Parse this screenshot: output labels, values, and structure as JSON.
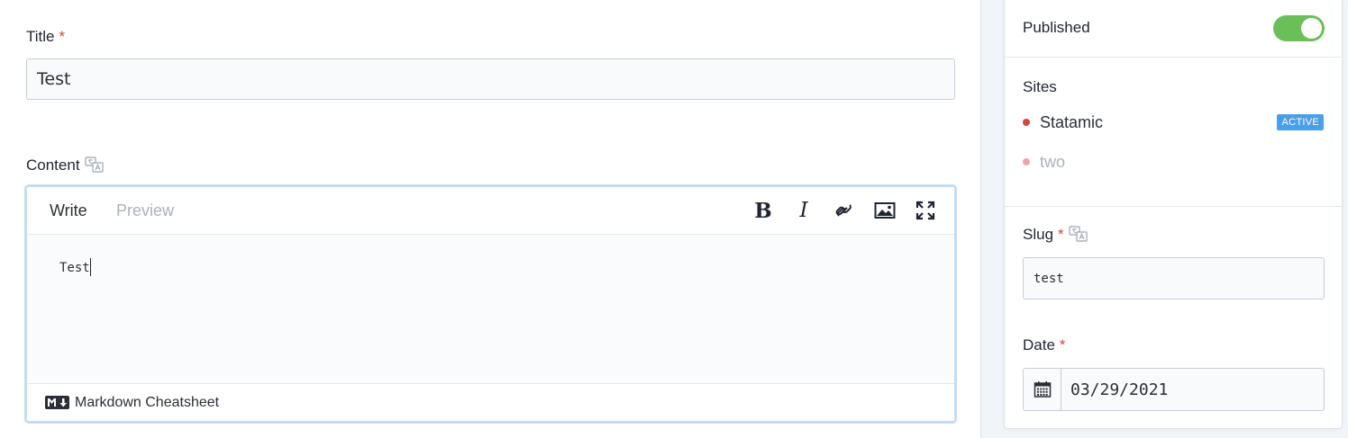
{
  "main": {
    "title_field": {
      "label": "Title",
      "required_mark": "*",
      "value": "Test"
    },
    "content_field": {
      "label": "Content",
      "tabs": {
        "write": "Write",
        "preview": "Preview"
      },
      "toolbar_icons": [
        "bold-icon",
        "italic-icon",
        "link-icon",
        "image-icon",
        "fullscreen-icon"
      ],
      "bold_glyph": "B",
      "italic_glyph": "I",
      "text": "Test",
      "footer_link": "Markdown Cheatsheet"
    }
  },
  "sidebar": {
    "published": {
      "label": "Published",
      "enabled": true
    },
    "sites": {
      "heading": "Sites",
      "items": [
        {
          "name": "Statamic",
          "badge": "ACTIVE",
          "dot_color": "#d0473f"
        },
        {
          "name": "two",
          "badge": "",
          "dot_color": "#eba7ac"
        }
      ]
    },
    "slug_field": {
      "label": "Slug",
      "required_mark": "*",
      "value": "test"
    },
    "date_field": {
      "label": "Date",
      "required_mark": "*",
      "value": "03/29/2021"
    }
  },
  "colors": {
    "accent_blue": "#4a9fe6",
    "toggle_green": "#6bbf59",
    "required_red": "#d0473f"
  }
}
